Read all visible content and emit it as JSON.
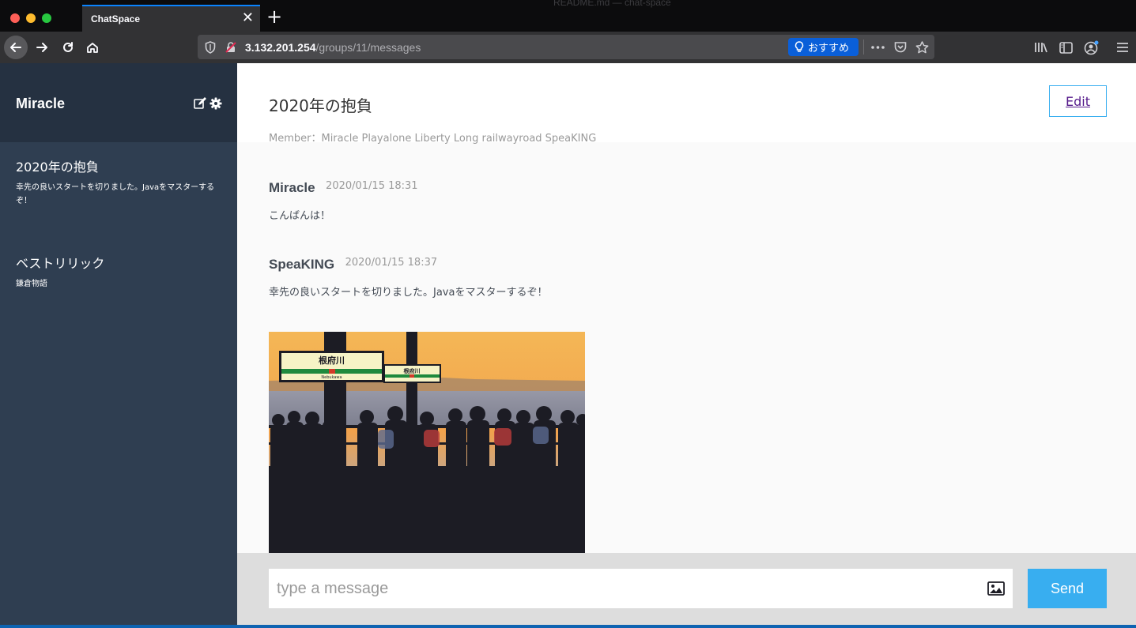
{
  "browser": {
    "background_window_title": "README.md — chat-space",
    "tab_title": "ChatSpace",
    "url_host": "3.132.201.254",
    "url_path": "/groups/11/messages",
    "recommend_label": "おすすめ",
    "accent_color": "#0a84ff"
  },
  "sidebar": {
    "user_name": "Miracle",
    "groups": [
      {
        "name": "2020年の抱負",
        "last_message": "幸先の良いスタートを切りました。Javaをマスターするぞ！"
      },
      {
        "name": "ベストリリック",
        "last_message": "鎌倉物語"
      }
    ],
    "colors": {
      "header": "#253141",
      "body": "#2f3e51"
    }
  },
  "main": {
    "group_title": "2020年の抱負",
    "member_list": "Member：Miracle Playalone Liberty Long railwayroad SpeaKING",
    "edit_label": "Edit",
    "messages": [
      {
        "user": "Miracle",
        "date": "2020/01/15 18:31",
        "text": "こんばんは！"
      },
      {
        "user": "SpeaKING",
        "date": "2020/01/15 18:37",
        "text": "幸先の良いスタートを切りました。Javaをマスターするぞ！"
      }
    ],
    "image_sign_text": "根府川",
    "image_sign_romaji": "Nebukawa"
  },
  "form": {
    "placeholder": "type a message",
    "send_label": "Send",
    "accent_color": "#38aef0"
  }
}
